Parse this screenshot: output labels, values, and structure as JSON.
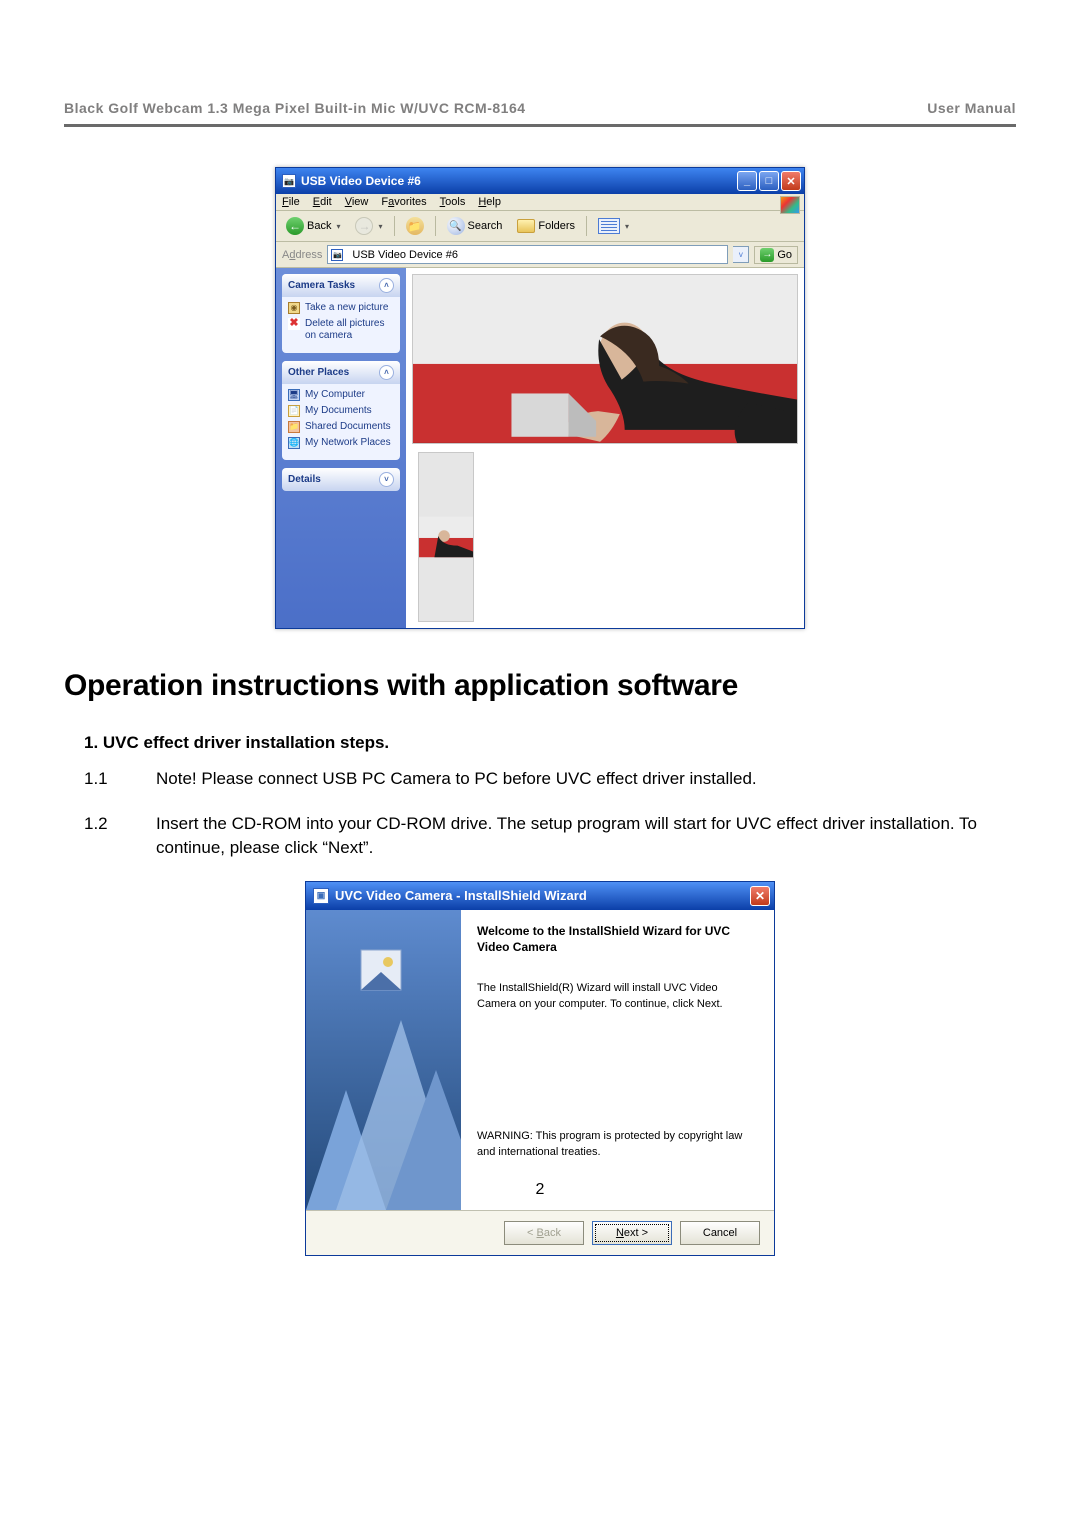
{
  "header": {
    "left": "Black Golf Webcam 1.3 Mega Pixel Built-in Mic W/UVC RCM-8164",
    "right": "User Manual"
  },
  "xp_window": {
    "title": "USB Video Device #6",
    "menu": [
      "File",
      "Edit",
      "View",
      "Favorites",
      "Tools",
      "Help"
    ],
    "menu_u": [
      "F",
      "E",
      "V",
      "a",
      "T",
      "H"
    ],
    "toolbar": {
      "back": "Back",
      "search": "Search",
      "folders": "Folders"
    },
    "address_label": "Address",
    "address_value": "USB Video Device #6",
    "go": "Go",
    "panes": {
      "camera": {
        "title": "Camera Tasks",
        "items": [
          "Take a new picture",
          "Delete all pictures on camera"
        ]
      },
      "places": {
        "title": "Other Places",
        "items": [
          "My Computer",
          "My Documents",
          "Shared Documents",
          "My Network Places"
        ]
      },
      "details": {
        "title": "Details"
      }
    }
  },
  "section_heading": "Operation instructions with application software",
  "step1_title": "1.  UVC effect driver installation steps.",
  "step11_num": "1.1",
  "step11_text": "Note! Please connect USB PC Camera to PC before UVC effect driver installed.",
  "step12_num": "1.2",
  "step12_text": "Insert the CD-ROM into your CD-ROM drive. The setup program will start for UVC effect driver installation. To continue, please click “Next”.",
  "wizard": {
    "title": "UVC Video Camera - InstallShield Wizard",
    "heading": "Welcome to the InstallShield Wizard for UVC Video Camera",
    "body": "The InstallShield(R) Wizard will install UVC Video Camera on your computer. To continue, click Next.",
    "warning": "WARNING: This program is protected by copyright law and international treaties.",
    "back": "< Back",
    "next": "Next >",
    "next_u": "N",
    "cancel": "Cancel"
  },
  "page_number": "2"
}
